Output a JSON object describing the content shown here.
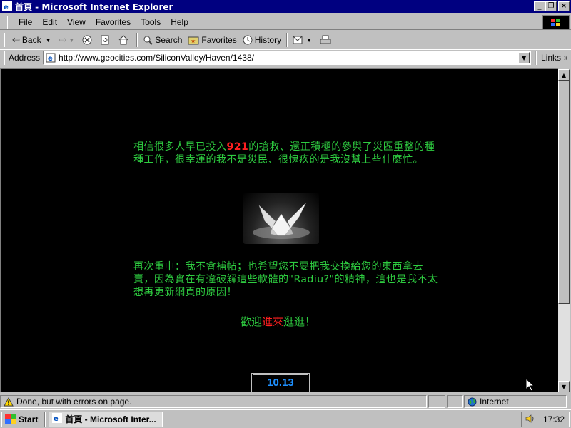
{
  "window": {
    "title": "首頁 - Microsoft Internet Explorer",
    "buttons": {
      "minimize": "_",
      "maximize": "❐",
      "close": "×"
    }
  },
  "menu": [
    {
      "label": "File",
      "accel": "F"
    },
    {
      "label": "Edit",
      "accel": "E"
    },
    {
      "label": "View",
      "accel": "V"
    },
    {
      "label": "Favorites",
      "accel": "a"
    },
    {
      "label": "Tools",
      "accel": "T"
    },
    {
      "label": "Help",
      "accel": "H"
    }
  ],
  "toolbar": {
    "back": "Back",
    "search": "Search",
    "favorites": "Favorites",
    "history": "History"
  },
  "address": {
    "label": "Address",
    "url": "http://www.geocities.com/SiliconValley/Haven/1438/",
    "links": "Links"
  },
  "page": {
    "para1_before": "相信很多人早已投入",
    "para1_highlight": "921",
    "para1_after": "的搶救、還正積極的參與了災區重整的種種工作，很幸運的我不是災民、很愧疚的是我沒幫上些什麼忙。",
    "para2": "再次重申：我不會補帖；也希望您不要把我交換給您的東西拿去賣，因為實在有違破解這些軟體的\"Radiu?\"的精神，這也是我不太想再更新網頁的原因！",
    "welcome_a": "歡迎",
    "welcome_b": "進來",
    "welcome_c": "逛逛！",
    "counter": "10.13"
  },
  "status": {
    "message": "Done, but with errors on page.",
    "zone": "Internet"
  },
  "taskbar": {
    "start": "Start",
    "task": "首頁 - Microsoft Inter...",
    "clock": "17:32"
  },
  "colors": {
    "text_green": "#2ecc40",
    "highlight_red": "#ff2020",
    "counter_blue": "#1e90ff",
    "titlebar": "#000080"
  }
}
